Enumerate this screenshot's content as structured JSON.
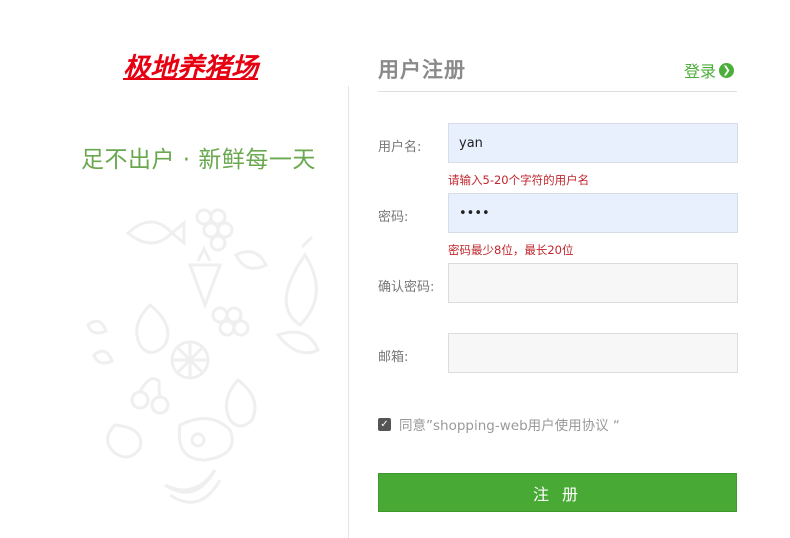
{
  "brand": {
    "logo_text": "极地养猪场",
    "logo_color": "#e60012"
  },
  "left": {
    "slogan": "足不出户 · 新鲜每一天"
  },
  "form": {
    "title": "用户注册",
    "login_link": "登录",
    "accent_color": "#4cae3a",
    "username": {
      "label": "用户名:",
      "value": "yan",
      "hint": "请输入5-20个字符的用户名"
    },
    "password": {
      "label": "密码:",
      "value": "••••",
      "hint": "密码最少8位，最长20位"
    },
    "confirm_password": {
      "label": "确认密码:",
      "value": ""
    },
    "email": {
      "label": "邮箱:",
      "value": ""
    },
    "agreement": {
      "checked": true,
      "text": "同意”shopping-web用户使用协议 “"
    },
    "submit_label": "注 册"
  },
  "icons": {
    "decor": [
      "fish-icon",
      "grapes-icon",
      "carrot-icon",
      "eggplant-icon",
      "leaf-icon",
      "pear-icon",
      "cherry-icon",
      "lemon-slice-icon",
      "meat-icon",
      "banana-icon",
      "apple-icon"
    ]
  }
}
